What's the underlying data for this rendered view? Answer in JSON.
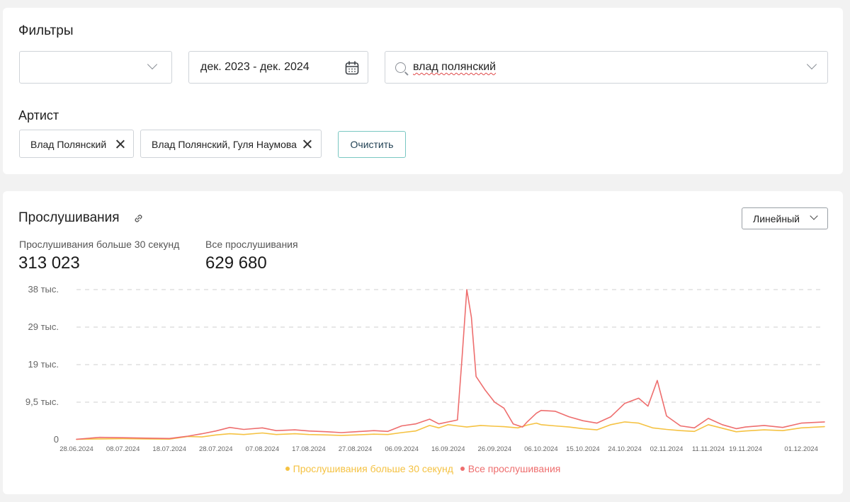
{
  "filters": {
    "title": "Фильтры",
    "select_value": "",
    "date_range": "дек. 2023 - дек. 2024",
    "search_value": "влад полянский",
    "artist_label": "Артист",
    "chips": [
      {
        "label": "Влад Полянский"
      },
      {
        "label": "Влад Полянский, Гуля Наумова"
      }
    ],
    "clear_label": "Очистить"
  },
  "listens": {
    "title": "Прослушивания",
    "chart_type_label": "Линейный",
    "stats": [
      {
        "label": "Прослушивания больше 30 секунд",
        "value": "313 023"
      },
      {
        "label": "Все прослушивания",
        "value": "629 680"
      }
    ]
  },
  "colors": {
    "all": "#ee6e6e",
    "over30": "#f5c242",
    "grid": "#cfcfcf",
    "accent_border": "#79c7c2"
  },
  "chart_data": {
    "type": "line",
    "y_ticks": [
      "38 тыс.",
      "29 тыс.",
      "19 тыс.",
      "9,5 тыс.",
      "0"
    ],
    "y_tick_values": [
      38000,
      28500,
      19000,
      9500,
      0
    ],
    "ylim": [
      0,
      38000
    ],
    "x_tick_labels": [
      "28.06.2024",
      "08.07.2024",
      "18.07.2024",
      "28.07.2024",
      "07.08.2024",
      "17.08.2024",
      "27.08.2024",
      "06.09.2024",
      "16.09.2024",
      "26.09.2024",
      "06.10.2024",
      "15.10.2024",
      "24.10.2024",
      "02.11.2024",
      "11.11.2024",
      "19.11.2024",
      "01.12.2024"
    ],
    "x_range": [
      "28.06.2024",
      "06.12.2024"
    ],
    "grid": true,
    "legend_position": "bottom-center",
    "series": [
      {
        "name": "Прослушивания больше 30 секунд",
        "color": "#f5c242",
        "points": [
          [
            "28.06.2024",
            100
          ],
          [
            "03.07.2024",
            200
          ],
          [
            "08.07.2024",
            250
          ],
          [
            "13.07.2024",
            200
          ],
          [
            "18.07.2024",
            150
          ],
          [
            "22.07.2024",
            800
          ],
          [
            "25.07.2024",
            700
          ],
          [
            "28.07.2024",
            1200
          ],
          [
            "31.07.2024",
            1500
          ],
          [
            "03.08.2024",
            1300
          ],
          [
            "07.08.2024",
            1700
          ],
          [
            "10.08.2024",
            1300
          ],
          [
            "14.08.2024",
            1500
          ],
          [
            "17.08.2024",
            1300
          ],
          [
            "21.08.2024",
            1200
          ],
          [
            "24.08.2024",
            1100
          ],
          [
            "27.08.2024",
            1200
          ],
          [
            "31.08.2024",
            1400
          ],
          [
            "03.09.2024",
            1300
          ],
          [
            "06.09.2024",
            1800
          ],
          [
            "09.09.2024",
            2200
          ],
          [
            "12.09.2024",
            3600
          ],
          [
            "14.09.2024",
            3000
          ],
          [
            "16.09.2024",
            3800
          ],
          [
            "18.09.2024",
            3500
          ],
          [
            "20.09.2024",
            3200
          ],
          [
            "23.09.2024",
            3600
          ],
          [
            "26.09.2024",
            3400
          ],
          [
            "28.09.2024",
            3300
          ],
          [
            "01.10.2024",
            3000
          ],
          [
            "03.10.2024",
            3700
          ],
          [
            "05.10.2024",
            4200
          ],
          [
            "06.10.2024",
            3800
          ],
          [
            "09.10.2024",
            3500
          ],
          [
            "12.10.2024",
            3200
          ],
          [
            "15.10.2024",
            2800
          ],
          [
            "18.10.2024",
            2500
          ],
          [
            "21.10.2024",
            3800
          ],
          [
            "24.10.2024",
            4500
          ],
          [
            "27.10.2024",
            4200
          ],
          [
            "30.10.2024",
            3000
          ],
          [
            "02.11.2024",
            2600
          ],
          [
            "05.11.2024",
            2300
          ],
          [
            "08.11.2024",
            2100
          ],
          [
            "11.11.2024",
            3800
          ],
          [
            "14.11.2024",
            2900
          ],
          [
            "17.11.2024",
            2000
          ],
          [
            "19.11.2024",
            2200
          ],
          [
            "23.11.2024",
            2500
          ],
          [
            "27.11.2024",
            2300
          ],
          [
            "01.12.2024",
            3000
          ],
          [
            "06.12.2024",
            3300
          ]
        ]
      },
      {
        "name": "Все прослушивания",
        "color": "#ee6e6e",
        "points": [
          [
            "28.06.2024",
            100
          ],
          [
            "03.07.2024",
            600
          ],
          [
            "08.07.2024",
            500
          ],
          [
            "13.07.2024",
            400
          ],
          [
            "18.07.2024",
            300
          ],
          [
            "22.07.2024",
            900
          ],
          [
            "25.07.2024",
            1500
          ],
          [
            "28.07.2024",
            2200
          ],
          [
            "31.07.2024",
            3100
          ],
          [
            "03.08.2024",
            2600
          ],
          [
            "07.08.2024",
            3000
          ],
          [
            "10.08.2024",
            2300
          ],
          [
            "14.08.2024",
            2500
          ],
          [
            "17.08.2024",
            2200
          ],
          [
            "21.08.2024",
            2000
          ],
          [
            "24.08.2024",
            1800
          ],
          [
            "27.08.2024",
            2000
          ],
          [
            "31.08.2024",
            2300
          ],
          [
            "03.09.2024",
            2100
          ],
          [
            "06.09.2024",
            3500
          ],
          [
            "09.09.2024",
            4000
          ],
          [
            "12.09.2024",
            5200
          ],
          [
            "14.09.2024",
            4000
          ],
          [
            "16.09.2024",
            4500
          ],
          [
            "18.09.2024",
            5000
          ],
          [
            "19.09.2024",
            21000
          ],
          [
            "20.09.2024",
            38000
          ],
          [
            "21.09.2024",
            31000
          ],
          [
            "22.09.2024",
            16000
          ],
          [
            "24.09.2024",
            12500
          ],
          [
            "26.09.2024",
            9500
          ],
          [
            "28.09.2024",
            8000
          ],
          [
            "30.09.2024",
            4000
          ],
          [
            "02.10.2024",
            3200
          ],
          [
            "03.10.2024",
            4500
          ],
          [
            "05.10.2024",
            6700
          ],
          [
            "06.10.2024",
            7400
          ],
          [
            "09.10.2024",
            7200
          ],
          [
            "12.10.2024",
            5800
          ],
          [
            "15.10.2024",
            4800
          ],
          [
            "18.10.2024",
            4200
          ],
          [
            "21.10.2024",
            5800
          ],
          [
            "24.10.2024",
            9200
          ],
          [
            "27.10.2024",
            10500
          ],
          [
            "29.10.2024",
            8500
          ],
          [
            "31.10.2024",
            15000
          ],
          [
            "02.11.2024",
            6000
          ],
          [
            "05.11.2024",
            3500
          ],
          [
            "08.11.2024",
            3000
          ],
          [
            "11.11.2024",
            5400
          ],
          [
            "14.11.2024",
            3800
          ],
          [
            "17.11.2024",
            2800
          ],
          [
            "19.11.2024",
            3200
          ],
          [
            "23.11.2024",
            3600
          ],
          [
            "27.11.2024",
            3100
          ],
          [
            "01.12.2024",
            4200
          ],
          [
            "06.12.2024",
            4500
          ]
        ]
      }
    ]
  }
}
